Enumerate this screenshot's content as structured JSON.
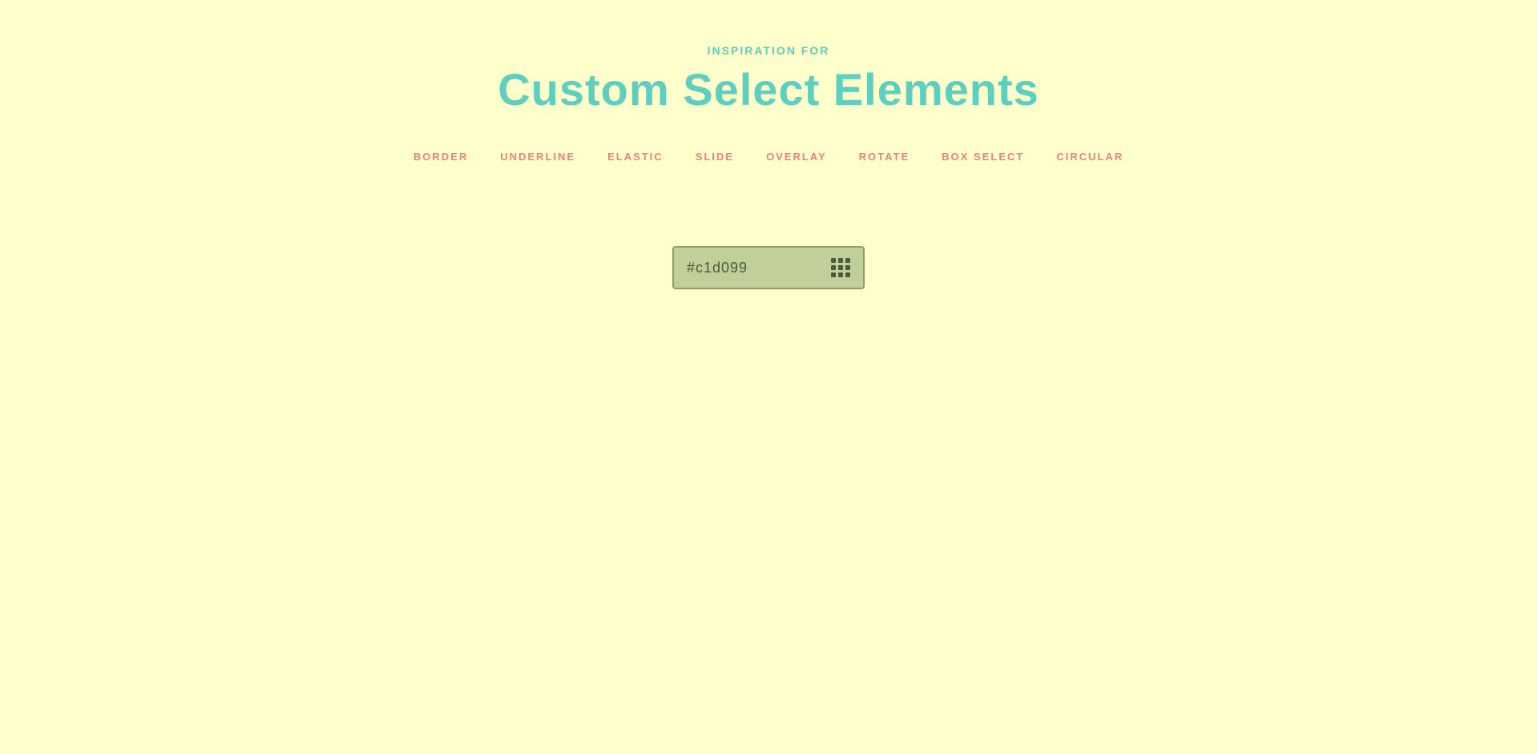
{
  "header": {
    "subtitle": "INSPIRATION FOR",
    "title": "Custom Select Elements"
  },
  "nav": {
    "items": [
      {
        "label": "BORDER",
        "id": "border"
      },
      {
        "label": "UNDERLINE",
        "id": "underline"
      },
      {
        "label": "ELASTIC",
        "id": "elastic"
      },
      {
        "label": "SLIDE",
        "id": "slide"
      },
      {
        "label": "OVERLAY",
        "id": "overlay"
      },
      {
        "label": "ROTATE",
        "id": "rotate"
      },
      {
        "label": "BOX SELECT",
        "id": "box-select"
      },
      {
        "label": "CIRCULAR",
        "id": "circular"
      }
    ]
  },
  "select": {
    "value": "#c1d099",
    "icon_label": "grid-icon"
  },
  "colors": {
    "background": "#ffffcc",
    "teal": "#5ecfbe",
    "salmon": "#f08080",
    "select_bg": "#c1d099",
    "select_border": "#8a9e6a",
    "select_text": "#4a5a3a"
  }
}
